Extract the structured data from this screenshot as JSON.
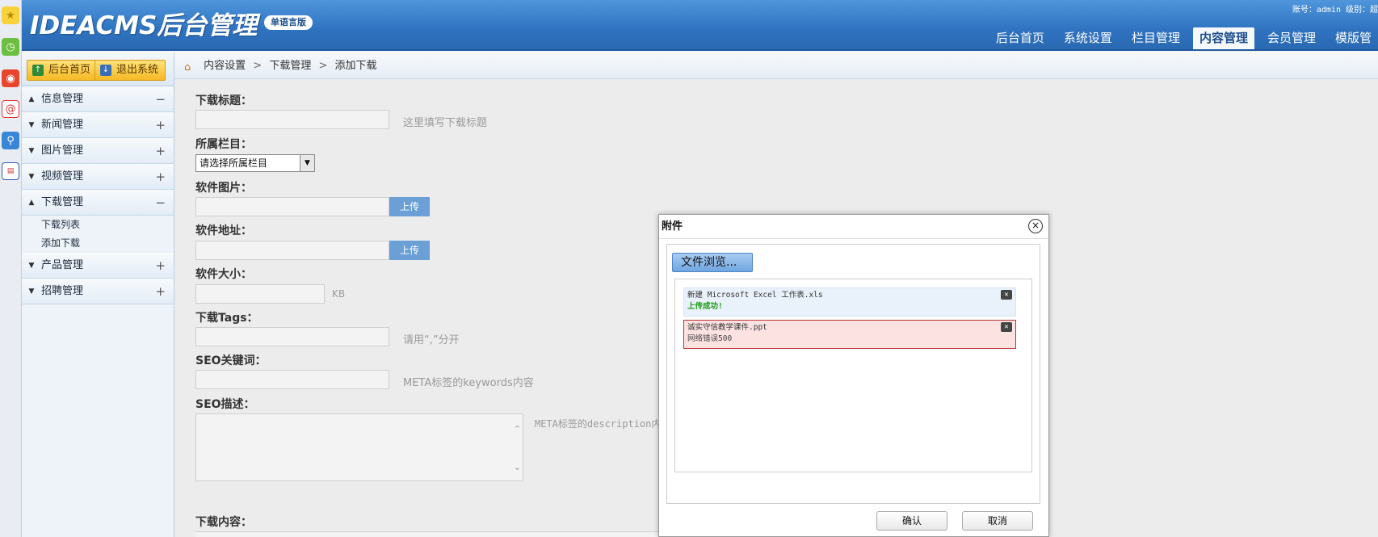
{
  "taskbar": {
    "icons": [
      "star-icon",
      "clock-icon",
      "weibo-icon",
      "mail-icon",
      "qq-icon",
      "news-icon"
    ]
  },
  "header": {
    "logo": "IDEACMS后台管理",
    "badge": "单语言版",
    "account": "账号：admin  级别：超",
    "nav": [
      "后台首页",
      "系统设置",
      "栏目管理",
      "内容管理",
      "会员管理",
      "模版管"
    ],
    "active_nav": "内容管理"
  },
  "sidebar": {
    "home_btn": "后台首页",
    "logout_btn": "退出系统",
    "menus": [
      {
        "label": "信息管理",
        "state": "−"
      },
      {
        "label": "新闻管理",
        "state": "+"
      },
      {
        "label": "图片管理",
        "state": "+"
      },
      {
        "label": "视频管理",
        "state": "+"
      },
      {
        "label": "下载管理",
        "state": "−"
      }
    ],
    "download_sub": [
      "下载列表",
      "添加下载"
    ],
    "menus_after": [
      {
        "label": "产品管理",
        "state": "+"
      },
      {
        "label": "招聘管理",
        "state": "+"
      }
    ]
  },
  "breadcrumb": [
    "内容设置",
    "下载管理",
    "添加下载"
  ],
  "form": {
    "title_label": "下载标题：",
    "title_hint": "这里填写下载标题",
    "category_label": "所属栏目：",
    "category_value": "请选择所属栏目",
    "image_label": "软件图片：",
    "upload_btn": "上传",
    "url_label": "软件地址：",
    "size_label": "软件大小：",
    "size_unit": "KB",
    "tags_label": "下载Tags：",
    "tags_hint": "请用“,”分开",
    "keywords_label": "SEO关键词：",
    "keywords_hint": "META标签的keywords内容",
    "desc_label": "SEO描述：",
    "desc_hint": "META标签的description内",
    "content_label": "下载内容："
  },
  "dialog": {
    "title": "附件",
    "browse_btn": "文件浏览...",
    "files": [
      {
        "name": "新建 Microsoft Excel 工作表.xls",
        "status": "上传成功!"
      },
      {
        "name": "诚实守信教学课件.ppt",
        "status": "网络错误500"
      }
    ],
    "confirm_btn": "确认",
    "cancel_btn": "取消"
  }
}
